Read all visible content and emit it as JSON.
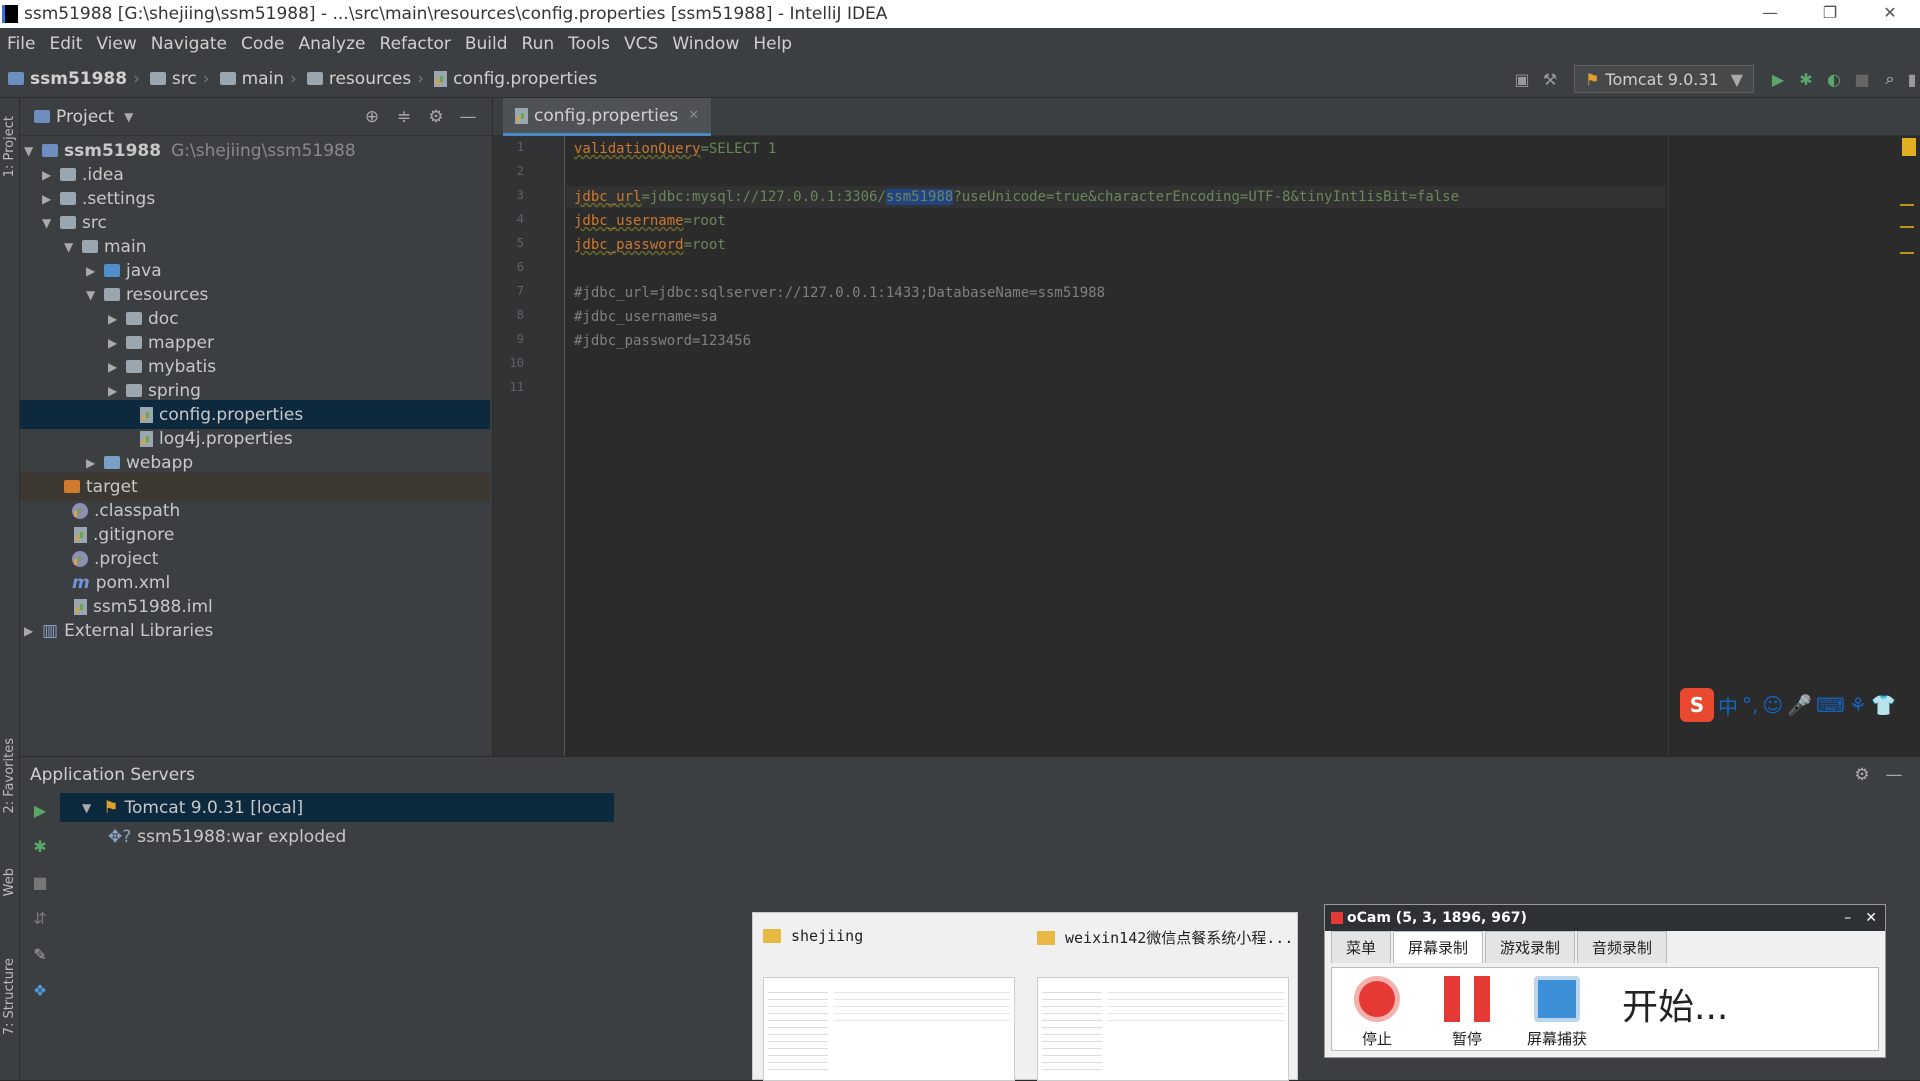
{
  "window": {
    "title": "ssm51988 [G:\\shejiing\\ssm51988] - ...\\src\\main\\resources\\config.properties [ssm51988] - IntelliJ IDEA"
  },
  "menu": [
    "File",
    "Edit",
    "View",
    "Navigate",
    "Code",
    "Analyze",
    "Refactor",
    "Build",
    "Run",
    "Tools",
    "VCS",
    "Window",
    "Help"
  ],
  "breadcrumb": [
    "ssm51988",
    "src",
    "main",
    "resources",
    "config.properties"
  ],
  "run_config": {
    "label": "Tomcat 9.0.31"
  },
  "project_panel": {
    "title": "Project",
    "tree": [
      {
        "label": "ssm51988",
        "extra": "G:\\shejiing\\ssm51988",
        "arrow": "▼",
        "kind": "module"
      },
      {
        "label": ".idea",
        "arrow": "▶",
        "kind": "folder"
      },
      {
        "label": ".settings",
        "arrow": "▶",
        "kind": "folder"
      },
      {
        "label": "src",
        "arrow": "▼",
        "kind": "folder"
      },
      {
        "label": "main",
        "arrow": "▼",
        "kind": "folder"
      },
      {
        "label": "java",
        "arrow": "▶",
        "kind": "folder-blue"
      },
      {
        "label": "resources",
        "arrow": "▼",
        "kind": "folder"
      },
      {
        "label": "doc",
        "arrow": "▶",
        "kind": "folder"
      },
      {
        "label": "mapper",
        "arrow": "▶",
        "kind": "folder"
      },
      {
        "label": "mybatis",
        "arrow": "▶",
        "kind": "folder"
      },
      {
        "label": "spring",
        "arrow": "▶",
        "kind": "folder"
      },
      {
        "label": "config.properties",
        "arrow": "",
        "kind": "file"
      },
      {
        "label": "log4j.properties",
        "arrow": "",
        "kind": "file"
      },
      {
        "label": "webapp",
        "arrow": "▶",
        "kind": "folder"
      },
      {
        "label": "target",
        "arrow": "",
        "kind": "folder-orange"
      },
      {
        "label": ".classpath",
        "arrow": "",
        "kind": "file-round"
      },
      {
        "label": ".gitignore",
        "arrow": "",
        "kind": "file"
      },
      {
        "label": ".project",
        "arrow": "",
        "kind": "file-round"
      },
      {
        "label": "pom.xml",
        "arrow": "",
        "kind": "maven"
      },
      {
        "label": "ssm51988.iml",
        "arrow": "",
        "kind": "file"
      },
      {
        "label": "External Libraries",
        "arrow": "▶",
        "kind": "lib"
      }
    ]
  },
  "editor": {
    "tab": "config.properties",
    "line_numbers": [
      "1",
      "2",
      "3",
      "4",
      "5",
      "6",
      "7",
      "8",
      "9",
      "10",
      "11"
    ],
    "lines": {
      "l1_key": "validationQuery",
      "l1_val": "=SELECT 1",
      "l3_key": "jdbc_url",
      "l3_a": "=jdbc:mysql://127.0.0.1:3306/",
      "l3_sel": "ssm51988",
      "l3_b": "?useUnicode=true&characterEncoding=UTF-8&tinyInt1isBit=false",
      "l4_key": "jdbc_username",
      "l4_val": "=root",
      "l5_key": "jdbc_password",
      "l5_val": "=root",
      "l7": "#jdbc_url=jdbc:sqlserver://127.0.0.1:1433;DatabaseName=ssm51988",
      "l8": "#jdbc_username=sa",
      "l9": "#jdbc_password=123456"
    }
  },
  "app_servers": {
    "title": "Application Servers",
    "server": "Tomcat 9.0.31 [local]",
    "artifact": "ssm51988:war exploded"
  },
  "left_tabs": {
    "project": "1: Project",
    "favorites": "2: Favorites",
    "web": "Web",
    "structure": "7: Structure"
  },
  "taskbar_previews": [
    {
      "title": "shejiing"
    },
    {
      "title": "weixin142微信点餐系统小程..."
    }
  ],
  "ocam": {
    "title": "oCam (5, 3, 1896, 967)",
    "tabs": [
      "菜单",
      "屏幕录制",
      "游戏录制",
      "音频录制"
    ],
    "stop": "停止",
    "pause": "暂停",
    "capture": "屏幕捕获",
    "status": "开始..."
  },
  "ime": {
    "logo": "S",
    "mode": "中"
  }
}
